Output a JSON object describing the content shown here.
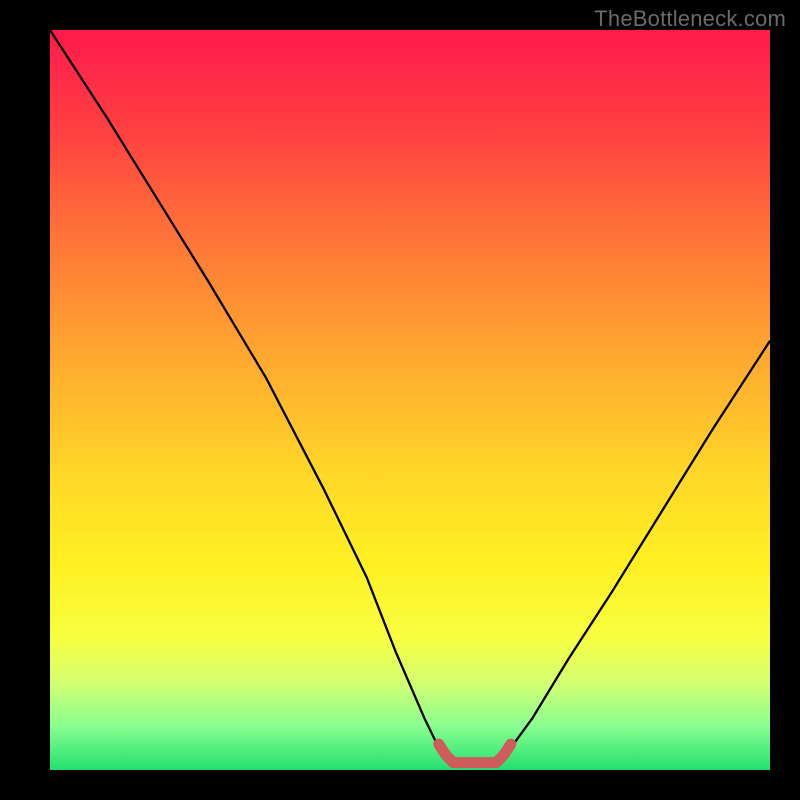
{
  "watermark": "TheBottleneck.com",
  "chart_data": {
    "type": "line",
    "title": "",
    "xlabel": "",
    "ylabel": "",
    "xlim": [
      0,
      100
    ],
    "ylim": [
      0,
      100
    ],
    "series": [
      {
        "name": "bottleneck-curve",
        "x": [
          0,
          8,
          15,
          22,
          30,
          38,
          44,
          48,
          52,
          54,
          56,
          60,
          62,
          64,
          67,
          72,
          78,
          85,
          92,
          100
        ],
        "values": [
          100,
          88,
          77,
          66,
          53,
          38,
          26,
          16,
          7,
          3,
          1,
          1,
          1,
          3,
          7,
          15,
          24,
          35,
          46,
          58
        ]
      },
      {
        "name": "optimal-range-marker",
        "x": [
          54,
          55,
          56,
          57,
          58,
          59,
          60,
          61,
          62,
          63,
          64
        ],
        "values": [
          3.5,
          2,
          1,
          1,
          1,
          1,
          1,
          1,
          1,
          2,
          3.5
        ]
      }
    ],
    "colors": {
      "curve": "#000000",
      "optimal_marker": "#cf5b5b",
      "gradient_top": "#ff1a4a",
      "gradient_bottom": "#22e070"
    }
  }
}
